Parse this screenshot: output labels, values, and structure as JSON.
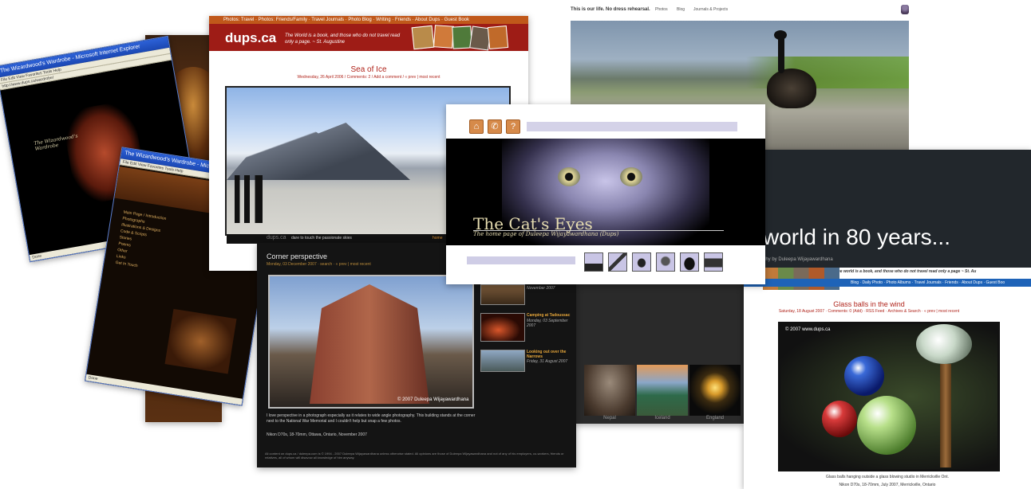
{
  "ie1": {
    "title": "The Wizardwood's Wardrobe - Microsoft Internet Explorer",
    "menu": "File  Edit  View  Favorites  Tools  Help",
    "address": "http://www.dups.ca/wardrobe/",
    "page_text": "The Wizardwood's Wardrobe",
    "status": "Done"
  },
  "ie2": {
    "title": "The Wizardwood's Wardrobe - Microsoft Internet Explorer",
    "menu": "File  Edit  View  Favorites  Tools  Help",
    "menu_items": [
      "Main Page / Introduction",
      "Photographs",
      "Illustrations & Designs",
      "Code & Scripts",
      "Stories",
      "Poems",
      "Other",
      "Links",
      "Get In Touch"
    ],
    "status": "Done"
  },
  "dups": {
    "nav": "Photos: Travel · Photos: Friends/Family · Travel Journals · Photo Blog · Writing · Friends · About Dups · Guest Book",
    "logo": "dups.ca",
    "tagline": "The World is a book, and those who do not travel read only a page. ~ St. Augustine",
    "post_title": "Sea of Ice",
    "post_meta": "Wednesday, 26 April 2006 / Comments: 2 / Add a comment / « prev | most recent",
    "caption_brand": "dups.ca",
    "caption_text": "dare to touch the passionate skies",
    "caption_home": "home"
  },
  "family": {
    "tagline": "This is our life. No dress rehearsal.",
    "nav": [
      "Photos",
      "Blog",
      "Journals & Projects"
    ]
  },
  "cat": {
    "title": "The Cat's Eyes",
    "subtitle": "The home page of Duleepa Wijayawardhana (Dups)",
    "icon_buttons": [
      "home-icon",
      "phone-icon",
      "help-icon"
    ],
    "nav_icons": [
      "boat-icon",
      "sailboat-icon",
      "bird-icon",
      "portrait-icon",
      "silhouette-icon",
      "church-icon"
    ]
  },
  "corner": {
    "title": "Corner perspective",
    "meta": "Monday, 03 December 2007 · search · « prev | most recent",
    "watermark": "© 2007 Duleepa Wijayawardhana",
    "body": "I love perspective in a photograph especially as it relates to wide angle photography. This building stands at the corner next to the National War Memorial and I couldn't help but snap a few photos.",
    "camera": "Nikon D70s, 18-70mm, Ottawa, Ontario, November 2007",
    "footer": "All content on dups.ca / duleepa.com is © 1994 - 2007 Duleepa Wijayawardhana unless otherwise stated. All opinions are those of Duleepa Wijayawardhana and not of any of his employers, co-workers, friends or relatives, all of whom will disavow all knowledge of him anyway.",
    "sidebar": [
      {
        "title": "",
        "date": "November 2007"
      },
      {
        "title": "Camping at Tadoussac",
        "date": "Monday, 03 September 2007"
      },
      {
        "title": "Looking out over the Narrows",
        "date": "Friday, 31 August 2007"
      }
    ]
  },
  "gallery": {
    "captions": [
      "Nepal",
      "Iceland",
      "England"
    ]
  },
  "world": {
    "headline": "world in 80 years...",
    "byline": "phy by Duleepa Wijayawardhana",
    "quote": "the world is a book, and those who do not travel read only a page ~ St. Au",
    "nav": "Blog · Daily Photo · Photo Albums · Travel Journals · Friends · About Dups · Guest Boo",
    "post_title": "Glass balls in the wind",
    "post_meta": "Saturday, 18 August 2007 · Comments: 0 (Add) · RSS Feed · Archives & Search · « prev | most recent",
    "watermark": "© 2007 www.dups.ca",
    "caption": "Glass balls hanging outside a glass blowing studio in Merrickville Ont.",
    "camera": "Nikon D70s, 18-70mm, July 2007, Merrickville, Ontario"
  }
}
